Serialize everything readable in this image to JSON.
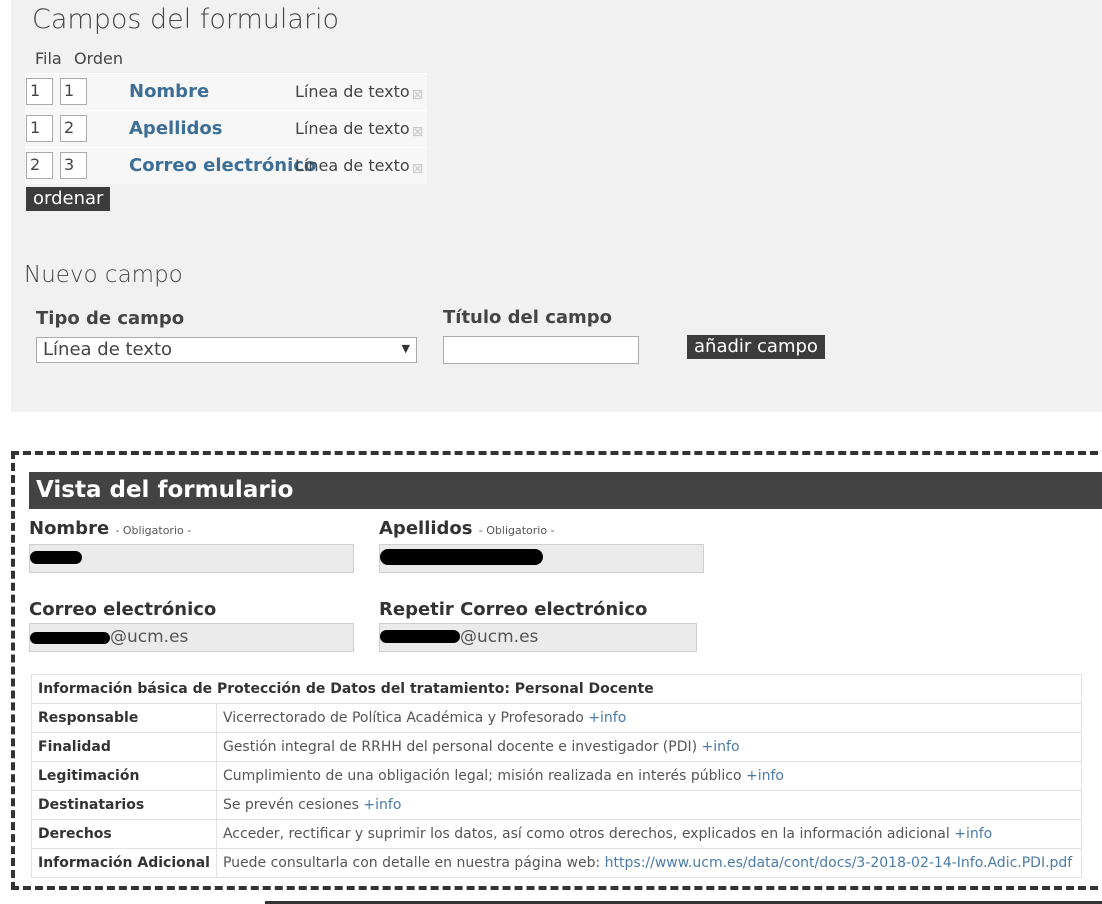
{
  "editor": {
    "title": "Campos del formulario",
    "col_fila": "Fila",
    "col_orden": "Orden",
    "fields": [
      {
        "fila": "1",
        "orden": "1",
        "name": "Nombre",
        "type": "Línea de texto"
      },
      {
        "fila": "1",
        "orden": "2",
        "name": "Apellidos",
        "type": "Línea de texto"
      },
      {
        "fila": "2",
        "orden": "3",
        "name": "Correo electrónico",
        "type": "Línea de texto"
      }
    ],
    "order_button": "ordenar"
  },
  "new_field": {
    "title": "Nuevo campo",
    "type_label": "Tipo de campo",
    "type_value": "Línea de texto",
    "title_label": "Título del campo",
    "title_value": "",
    "add_button": "añadir campo"
  },
  "preview": {
    "title": "Vista del formulario",
    "required_tag": "- Obligatorio -",
    "fields": {
      "nombre": {
        "label": "Nombre"
      },
      "apellidos": {
        "label": "Apellidos"
      },
      "correo": {
        "label": "Correo electrónico",
        "value_suffix": "@ucm.es"
      },
      "repetir": {
        "label": "Repetir Correo electrónico",
        "value_suffix": "@ucm.es"
      }
    },
    "data_protection": {
      "heading": "Información básica de Protección de Datos del tratamiento: Personal Docente",
      "rows": [
        {
          "key": "Responsable",
          "text": "Vicerrectorado de Política Académica y Profesorado",
          "link": "+info"
        },
        {
          "key": "Finalidad",
          "text": "Gestión integral de RRHH del personal docente e investigador (PDI)",
          "link": "+info"
        },
        {
          "key": "Legitimación",
          "text": "Cumplimiento de una obligación legal; misión realizada en interés público",
          "link": "+info"
        },
        {
          "key": "Destinatarios",
          "text": "Se prevén cesiones",
          "link": "+info"
        },
        {
          "key": "Derechos",
          "text": "Acceder, rectificar y suprimir los datos, así como otros derechos, explicados en la información adicional",
          "link": "+info"
        },
        {
          "key": "Información Adicional",
          "text": "Puede consultarla con detalle en nuestra página web:",
          "link": "https://www.ucm.es/data/cont/docs/3-2018-02-14-Info.Adic.PDI.pdf"
        }
      ]
    }
  },
  "icons": {
    "delete": "delete-x-icon",
    "select_arrow": "dropdown-arrow-icon"
  },
  "colors": {
    "link": "#4a7ba7",
    "field_name": "#3d6f96",
    "dark_button": "#3c3c3c",
    "header_bar": "#434343"
  }
}
